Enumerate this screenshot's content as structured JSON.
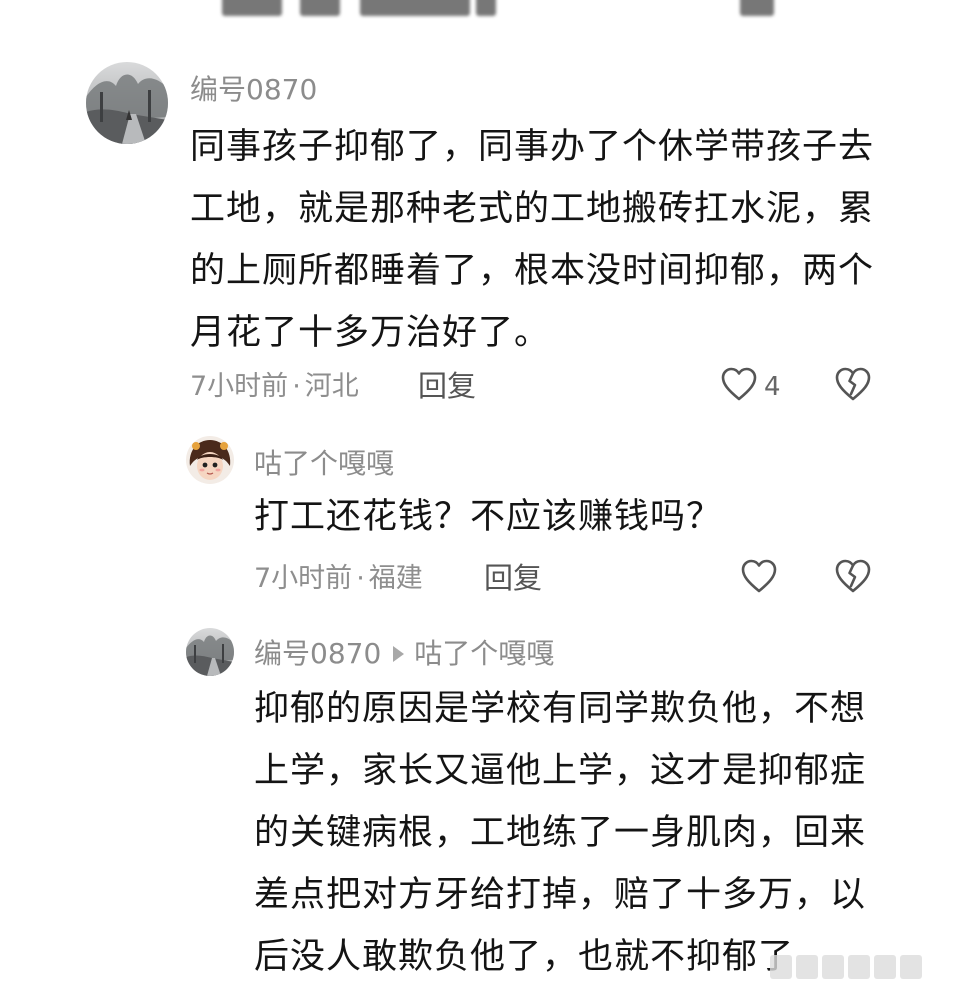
{
  "comments": [
    {
      "username": "编号0870",
      "body": "同事孩子抑郁了，同事办了个休学带孩子去\n工地，就是那种老式的工地搬砖扛水泥，累\n的上厕所都睡着了，根本没时间抑郁，两个\n月花了十多万治好了。",
      "time": "7小时前",
      "location": "河北",
      "reply_label": "回复",
      "like_count": "4",
      "avatar_icon": "avatar-tree-road-photo",
      "like_icon": "heart-outline-icon",
      "dislike_icon": "broken-heart-icon"
    },
    {
      "username": "咕了个嘎嘎",
      "body": "打工还花钱？不应该赚钱吗？",
      "time": "7小时前",
      "location": "福建",
      "reply_label": "回复",
      "avatar_icon": "avatar-cartoon-girl",
      "like_icon": "heart-outline-icon",
      "dislike_icon": "broken-heart-icon"
    },
    {
      "username": "编号0870",
      "reply_to": "咕了个嘎嘎",
      "body": "抑郁的原因是学校有同学欺负他，不想\n上学，家长又逼他上学，这才是抑郁症\n的关键病根，工地练了一身肌肉，回来\n差点把对方牙给打掉，赔了十多万，以\n后没人敢欺负他了，也就不抑郁了",
      "avatar_icon": "avatar-tree-road-photo"
    }
  ],
  "colors": {
    "text_primary": "#141414",
    "text_secondary": "#8c8c8c",
    "icon_stroke": "#555555",
    "background": "#ffffff"
  }
}
